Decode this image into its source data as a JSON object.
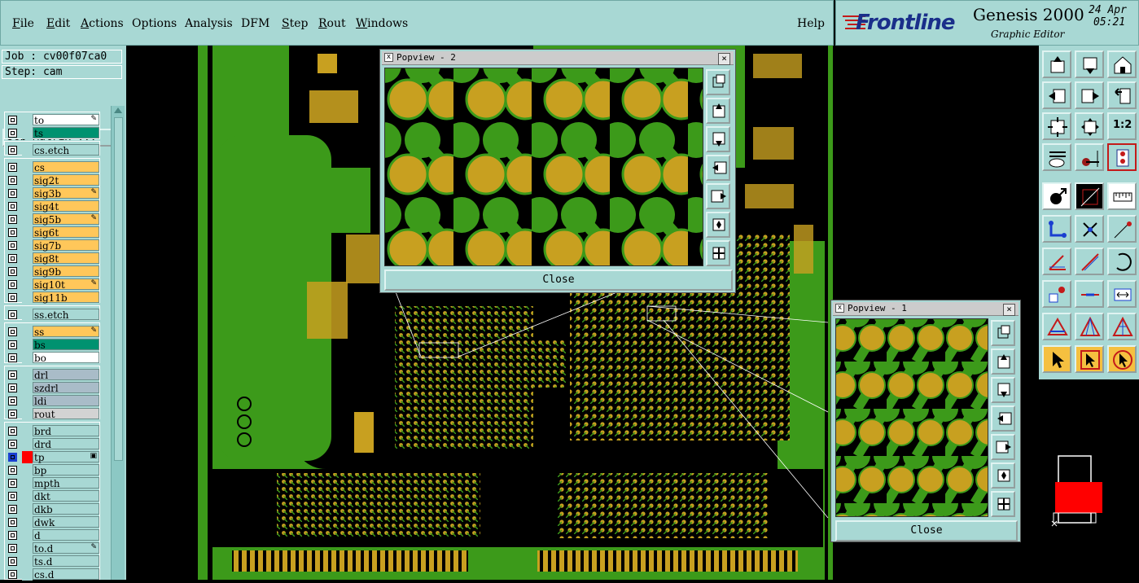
{
  "menu": {
    "file": "File",
    "edit": "Edit",
    "actions": "Actions",
    "options": "Options",
    "analysis": "Analysis",
    "dfm": "DFM",
    "step": "Step",
    "rout": "Rout",
    "windows": "Windows",
    "help": "Help"
  },
  "brand": {
    "logo": "Frontline",
    "product": "Genesis 2000",
    "subtitle": "Graphic Editor",
    "date": "24 Apr",
    "time": "05:21"
  },
  "job": {
    "job_label": "Job : cv00f07ca0",
    "step_label": "Step: cam",
    "matrix_button": "Job Matrix ..."
  },
  "layers": [
    {
      "name": "to",
      "color": "#ffffff",
      "swatch": "#a8d8d4",
      "icon": "✎"
    },
    {
      "name": "ts",
      "color": "#009270",
      "swatch": "#a8d8d4",
      "icon": ""
    },
    {
      "name": "cs.etch",
      "color": "#a8d8d4",
      "swatch": "#a8d8d4",
      "icon": ""
    },
    {
      "name": "cs",
      "color": "#ffc75a",
      "swatch": "#a8d8d4",
      "icon": ""
    },
    {
      "name": "sig2t",
      "color": "#ffc75a",
      "swatch": "#a8d8d4",
      "icon": ""
    },
    {
      "name": "sig3b",
      "color": "#ffc75a",
      "swatch": "#a8d8d4",
      "icon": "✎"
    },
    {
      "name": "sig4t",
      "color": "#ffc75a",
      "swatch": "#a8d8d4",
      "icon": ""
    },
    {
      "name": "sig5b",
      "color": "#ffc75a",
      "swatch": "#a8d8d4",
      "icon": "✎"
    },
    {
      "name": "sig6t",
      "color": "#ffc75a",
      "swatch": "#a8d8d4",
      "icon": ""
    },
    {
      "name": "sig7b",
      "color": "#ffc75a",
      "swatch": "#a8d8d4",
      "icon": ""
    },
    {
      "name": "sig8t",
      "color": "#ffc75a",
      "swatch": "#a8d8d4",
      "icon": ""
    },
    {
      "name": "sig9b",
      "color": "#ffc75a",
      "swatch": "#a8d8d4",
      "icon": ""
    },
    {
      "name": "sig10t",
      "color": "#ffc75a",
      "swatch": "#a8d8d4",
      "icon": "✎"
    },
    {
      "name": "sig11b",
      "color": "#ffc75a",
      "swatch": "#a8d8d4",
      "icon": ""
    },
    {
      "name": "ss.etch",
      "color": "#a8d8d4",
      "swatch": "#a8d8d4",
      "icon": ""
    },
    {
      "name": "ss",
      "color": "#ffc75a",
      "swatch": "#a8d8d4",
      "icon": "✎"
    },
    {
      "name": "bs",
      "color": "#009270",
      "swatch": "#a8d8d4",
      "icon": ""
    },
    {
      "name": "bo",
      "color": "#ffffff",
      "swatch": "#a8d8d4",
      "icon": ""
    },
    {
      "name": "drl",
      "color": "#a9bcc8",
      "swatch": "#a8d8d4",
      "icon": ""
    },
    {
      "name": "szdrl",
      "color": "#a9bcc8",
      "swatch": "#a8d8d4",
      "icon": ""
    },
    {
      "name": "ldi",
      "color": "#a9bcc8",
      "swatch": "#a8d8d4",
      "icon": ""
    },
    {
      "name": "rout",
      "color": "#d3d3d3",
      "swatch": "#a8d8d4",
      "icon": ""
    },
    {
      "name": "brd",
      "color": "#a8d8d4",
      "swatch": "#a8d8d4",
      "icon": ""
    },
    {
      "name": "drd",
      "color": "#a8d8d4",
      "swatch": "#a8d8d4",
      "icon": ""
    },
    {
      "name": "tp",
      "color": "#a8d8d4",
      "swatch": "#ff0000",
      "icon": "▣"
    },
    {
      "name": "bp",
      "color": "#a8d8d4",
      "swatch": "#a8d8d4",
      "icon": ""
    },
    {
      "name": "mpth",
      "color": "#a8d8d4",
      "swatch": "#a8d8d4",
      "icon": ""
    },
    {
      "name": "dkt",
      "color": "#a8d8d4",
      "swatch": "#a8d8d4",
      "icon": ""
    },
    {
      "name": "dkb",
      "color": "#a8d8d4",
      "swatch": "#a8d8d4",
      "icon": ""
    },
    {
      "name": "dwk",
      "color": "#a8d8d4",
      "swatch": "#a8d8d4",
      "icon": ""
    },
    {
      "name": "d",
      "color": "#a8d8d4",
      "swatch": "#a8d8d4",
      "icon": ""
    },
    {
      "name": "to.d",
      "color": "#a8d8d4",
      "swatch": "#a8d8d4",
      "icon": "✎"
    },
    {
      "name": "ts.d",
      "color": "#a8d8d4",
      "swatch": "#a8d8d4",
      "icon": ""
    },
    {
      "name": "cs.d",
      "color": "#a8d8d4",
      "swatch": "#a8d8d4",
      "icon": ""
    }
  ],
  "popview2": {
    "title": "Popview - 2",
    "close_label": "Close",
    "x_glyph": "×"
  },
  "popview1": {
    "title": "Popview - 1",
    "close_label": "Close",
    "x_glyph": "×"
  },
  "toolbar": {
    "ratio_label": "1:2"
  },
  "colors": {
    "ui_bg": "#a8d8d4",
    "board_green": "#3c9a1a",
    "pad_gold": "#c8a020",
    "layer_orange": "#ffc75a",
    "layer_teal": "#009270",
    "highlight_red": "#ff0000"
  }
}
